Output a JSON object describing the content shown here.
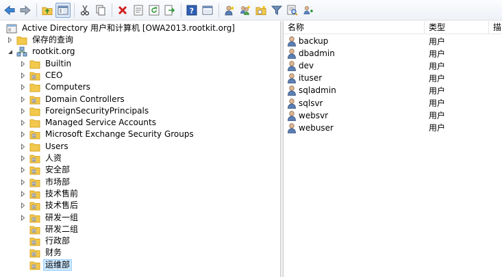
{
  "toolbar": {
    "buttons": [
      {
        "name": "back-icon",
        "glyph": "back"
      },
      {
        "name": "forward-icon",
        "glyph": "forward"
      },
      {
        "sep": true
      },
      {
        "name": "up-folder-icon",
        "glyph": "upfolder"
      },
      {
        "name": "show-tree-icon",
        "glyph": "showtree",
        "active": true
      },
      {
        "sep": true
      },
      {
        "name": "cut-icon",
        "glyph": "cut"
      },
      {
        "name": "copy-icon",
        "glyph": "copy"
      },
      {
        "sep": true
      },
      {
        "name": "delete-icon",
        "glyph": "delete"
      },
      {
        "name": "properties-icon",
        "glyph": "props"
      },
      {
        "name": "refresh-icon",
        "glyph": "refresh"
      },
      {
        "name": "export-list-icon",
        "glyph": "export"
      },
      {
        "sep": true
      },
      {
        "name": "help-icon",
        "glyph": "help"
      },
      {
        "name": "show-console-icon",
        "glyph": "console"
      },
      {
        "sep": true
      },
      {
        "name": "new-user-icon",
        "glyph": "user"
      },
      {
        "name": "new-group-icon",
        "glyph": "group"
      },
      {
        "name": "new-ou-icon",
        "glyph": "ou"
      },
      {
        "name": "filter-icon",
        "glyph": "filter"
      },
      {
        "name": "find-icon",
        "glyph": "find"
      },
      {
        "name": "add-to-group-icon",
        "glyph": "addgroup"
      }
    ]
  },
  "tree": {
    "root": {
      "label": "Active Directory 用户和计算机 [OWA2013.rootkit.org]",
      "icon": "ad-console-icon"
    },
    "items": [
      {
        "label": "保存的查询",
        "icon": "folder",
        "depth": 1,
        "expander": "collapsed"
      },
      {
        "label": "rootkit.org",
        "icon": "domain",
        "depth": 1,
        "expander": "expanded"
      },
      {
        "label": "Builtin",
        "icon": "folder",
        "depth": 2,
        "expander": "collapsed"
      },
      {
        "label": "CEO",
        "icon": "ou",
        "depth": 2,
        "expander": "collapsed"
      },
      {
        "label": "Computers",
        "icon": "folder",
        "depth": 2,
        "expander": "collapsed"
      },
      {
        "label": "Domain Controllers",
        "icon": "ou",
        "depth": 2,
        "expander": "collapsed"
      },
      {
        "label": "ForeignSecurityPrincipals",
        "icon": "folder",
        "depth": 2,
        "expander": "collapsed"
      },
      {
        "label": "Managed Service Accounts",
        "icon": "folder",
        "depth": 2,
        "expander": "collapsed"
      },
      {
        "label": "Microsoft Exchange Security Groups",
        "icon": "ou",
        "depth": 2,
        "expander": "collapsed"
      },
      {
        "label": "Users",
        "icon": "folder",
        "depth": 2,
        "expander": "collapsed"
      },
      {
        "label": "人资",
        "icon": "ou",
        "depth": 2,
        "expander": "collapsed"
      },
      {
        "label": "安全部",
        "icon": "ou",
        "depth": 2,
        "expander": "collapsed"
      },
      {
        "label": "市场部",
        "icon": "ou",
        "depth": 2,
        "expander": "collapsed"
      },
      {
        "label": "技术售前",
        "icon": "ou",
        "depth": 2,
        "expander": "collapsed"
      },
      {
        "label": "技术售后",
        "icon": "ou",
        "depth": 2,
        "expander": "collapsed"
      },
      {
        "label": "研发一组",
        "icon": "ou",
        "depth": 2,
        "expander": "collapsed"
      },
      {
        "label": "研发二组",
        "icon": "ou",
        "depth": 2,
        "expander": "none"
      },
      {
        "label": "行政部",
        "icon": "ou",
        "depth": 2,
        "expander": "none"
      },
      {
        "label": "财务",
        "icon": "ou",
        "depth": 2,
        "expander": "none"
      },
      {
        "label": "运维部",
        "icon": "ou",
        "depth": 2,
        "expander": "none",
        "selected": true
      }
    ]
  },
  "list": {
    "columns": [
      "名称",
      "类型",
      "描"
    ],
    "rows": [
      {
        "name": "backup",
        "type": "用户"
      },
      {
        "name": "dbadmin",
        "type": "用户"
      },
      {
        "name": "dev",
        "type": "用户"
      },
      {
        "name": "ituser",
        "type": "用户"
      },
      {
        "name": "sqladmin",
        "type": "用户"
      },
      {
        "name": "sqlsvr",
        "type": "用户"
      },
      {
        "name": "websvr",
        "type": "用户"
      },
      {
        "name": "webuser",
        "type": "用户"
      }
    ]
  },
  "colors": {
    "folder": "#f2c94c",
    "folder_dark": "#d9a520",
    "selection": "#cce8ff",
    "user_head": "#e0b894",
    "user_body": "#5b7fb4"
  }
}
